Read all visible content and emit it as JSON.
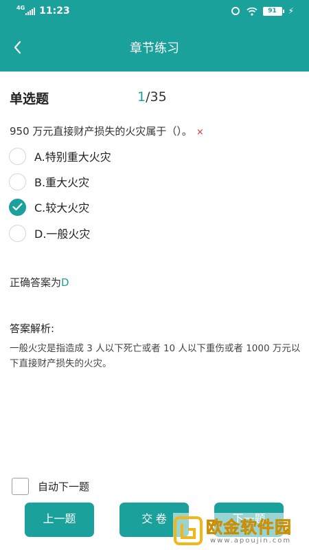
{
  "status_bar": {
    "network": "4G",
    "time": "11:23",
    "battery": "91"
  },
  "header": {
    "title": "章节练习"
  },
  "question": {
    "type": "单选题",
    "current": "1",
    "total": "/35",
    "text": "950 万元直接财产损失的火灾属于（）。",
    "wrong_mark": "×",
    "options": [
      {
        "label": "A.特别重大火灾",
        "checked": false
      },
      {
        "label": "B.重大火灾",
        "checked": false
      },
      {
        "label": "C.较大火灾",
        "checked": true
      },
      {
        "label": "D.一般火灾",
        "checked": false
      }
    ]
  },
  "answer": {
    "prefix": "正确答案为",
    "value": "D"
  },
  "analysis": {
    "title": "答案解析:",
    "text": "一般火灾是指造成 3 人以下死亡或者 10 人以下重伤或者 1000 万元以下直接财产损失的火灾。"
  },
  "footer": {
    "auto_next_label": "自动下一题",
    "prev_label": "上一题",
    "submit_label": "交 卷",
    "next_label": "下一题"
  },
  "watermark": {
    "brand": "欧金软件园",
    "url": "www.apoujin.com"
  },
  "colors": {
    "accent": "#1ba19c",
    "wrong": "#e0322f",
    "watermark": "#f2b618"
  }
}
